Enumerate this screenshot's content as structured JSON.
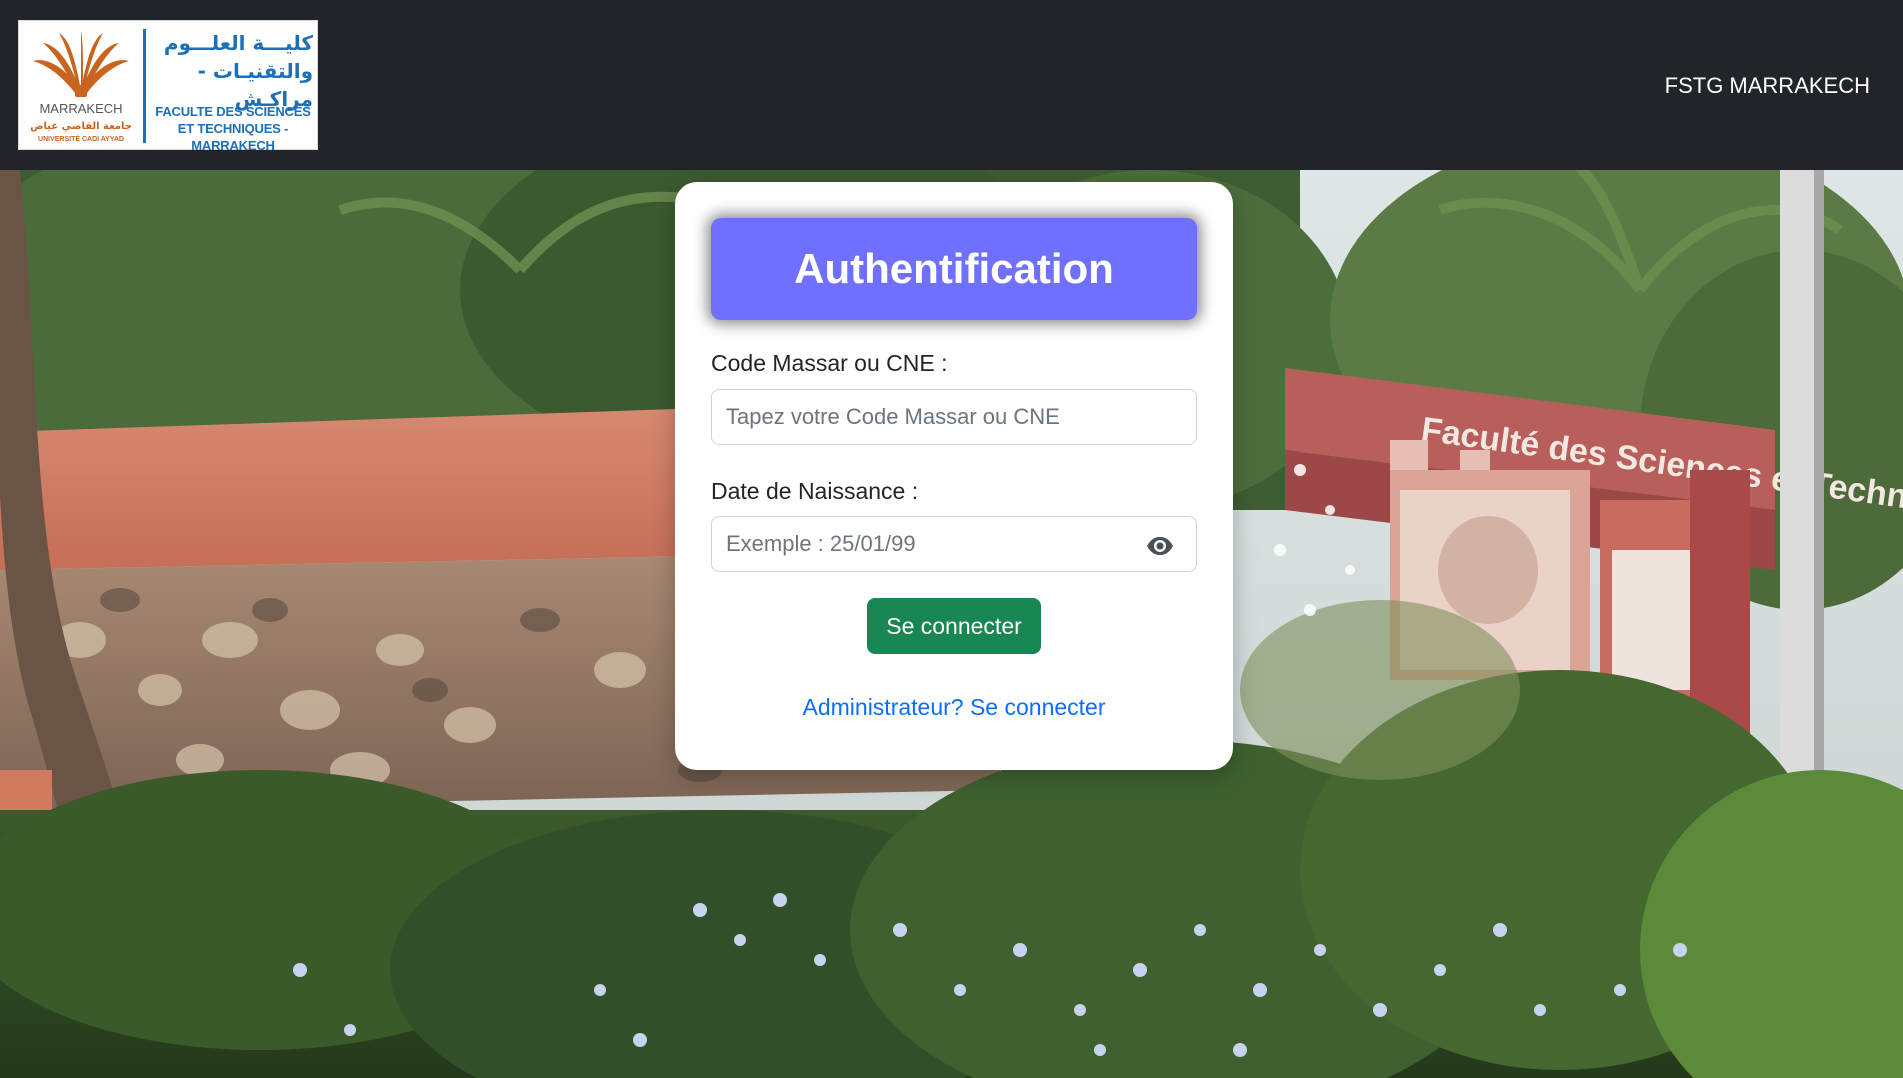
{
  "navbar": {
    "logo": {
      "emblem_text": "MARRAKECH",
      "emblem_subtext_ar": "جامعة القاضي عياض",
      "emblem_subtext_fr": "UNIVERSITÉ CADI AYYAD",
      "arabic_line1": "كليـــة العلـــوم",
      "arabic_line2": "والتقنيـات - مراكـش",
      "french_line1": "FACULTE DES SCIENCES",
      "french_line2": "ET TECHNIQUES - MARRAKECH"
    },
    "brand": "FSTG MARRAKECH"
  },
  "background": {
    "building_sign": "Faculté des Sciences et Technique . Marrakech"
  },
  "login": {
    "title": "Authentification",
    "massar_label": "Code Massar ou CNE :",
    "massar_placeholder": "Tapez votre Code Massar ou CNE",
    "massar_value": "",
    "dob_label": "Date de Naissance :",
    "dob_placeholder": "Exemple : 25/01/99",
    "dob_value": "",
    "submit_label": "Se connecter",
    "admin_link": "Administrateur? Se connecter"
  },
  "colors": {
    "navbar_bg": "#212529",
    "header_bg": "#7070ff",
    "submit_bg": "#198754",
    "link": "#0d6efd",
    "logo_blue": "#1d6fb8",
    "logo_orange": "#c8641e"
  },
  "icons": {
    "password_toggle": "eye-icon",
    "logo": "university-emblem-icon"
  }
}
